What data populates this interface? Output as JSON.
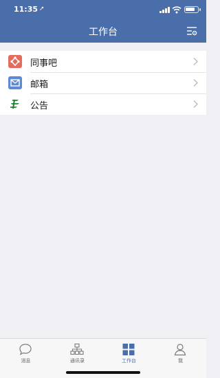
{
  "status_bar": {
    "time": "11:35",
    "location_glyph": "➚",
    "battery_level": 0.8
  },
  "header": {
    "title": "工作台",
    "settings_icon": "list-settings-icon"
  },
  "list": {
    "items": [
      {
        "label": "同事吧",
        "icon": "colleague-bar-icon",
        "color": "#e26d5c"
      },
      {
        "label": "邮箱",
        "icon": "mail-icon",
        "color": "#5d8ad3"
      },
      {
        "label": "公告",
        "icon": "announcement-icon",
        "color": "#2f9a44"
      }
    ]
  },
  "tabbar": {
    "tabs": [
      {
        "label": "消息",
        "icon": "chat-bubble-icon",
        "active": false
      },
      {
        "label": "通讯录",
        "icon": "org-chart-icon",
        "active": false
      },
      {
        "label": "工作台",
        "icon": "grid-icon",
        "active": true
      },
      {
        "label": "我",
        "icon": "person-icon",
        "active": false
      }
    ]
  },
  "colors": {
    "primary": "#4a6ea9",
    "background": "#efeff4"
  }
}
